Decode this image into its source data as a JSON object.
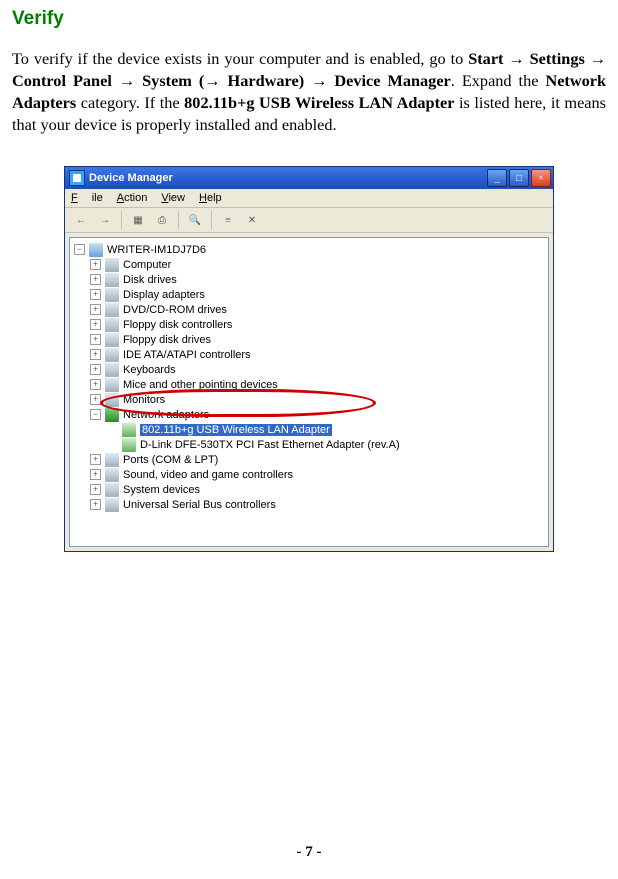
{
  "heading": "Verify",
  "paragraph": {
    "p1": "To verify if the device exists in your computer and is enabled, go to ",
    "b1": "Start",
    "arr": " → ",
    "b2": "Settings",
    "b3": "Control Panel",
    "b4": "System (",
    "b4b": " Hardware)",
    "b5": "Device Manager",
    "p2": ". Expand the ",
    "b6": "Network Adapters",
    "p3": " category. If the ",
    "b7": "802.11b+g USB Wireless LAN Adapter",
    "p4": " is listed here, it means that your device is properly installed and enabled."
  },
  "window": {
    "title": "Device Manager",
    "menu": {
      "file": "File",
      "action": "Action",
      "view": "View",
      "help": "Help"
    }
  },
  "tree": {
    "root": "WRITER-IM1DJ7D6",
    "items": [
      "Computer",
      "Disk drives",
      "Display adapters",
      "DVD/CD-ROM drives",
      "Floppy disk controllers",
      "Floppy disk drives",
      "IDE ATA/ATAPI controllers",
      "Keyboards",
      "Mice and other pointing devices",
      "Monitors"
    ],
    "netadapters": "Network adapters",
    "selected": "802.11b+g USB Wireless LAN Adapter",
    "nic2": "D-Link DFE-530TX PCI Fast Ethernet Adapter (rev.A)",
    "items2": [
      "Ports (COM & LPT)",
      "Sound, video and game controllers",
      "System devices",
      "Universal Serial Bus controllers"
    ]
  },
  "page_number": "- 7 -"
}
